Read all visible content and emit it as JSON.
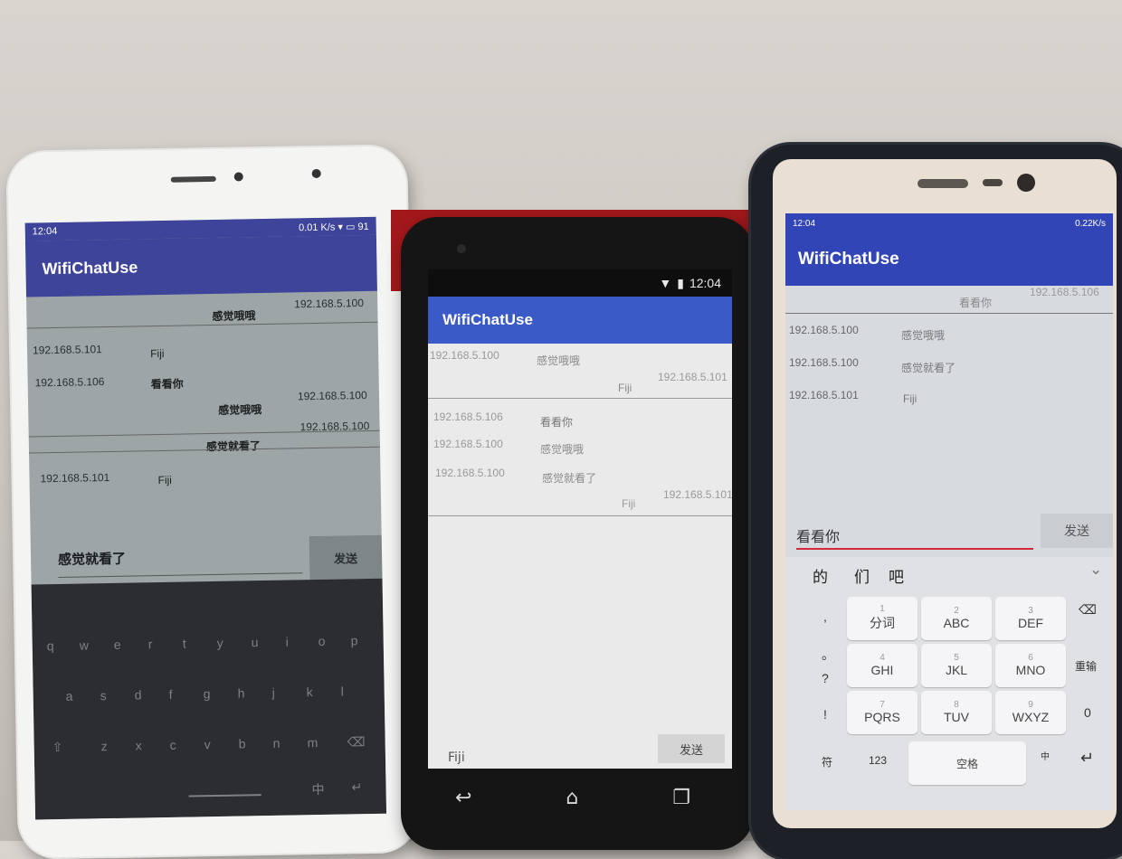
{
  "phone_left": {
    "status": {
      "time": "12:04",
      "right": "0.01 K/s",
      "battery": "91"
    },
    "app_title": "WifiChatUse",
    "messages": [
      {
        "ip": "192.168.5.100",
        "text": "感觉哦哦",
        "side": "right"
      },
      {
        "ip": "192.168.5.101",
        "text": "Fiji",
        "side": "left"
      },
      {
        "ip": "192.168.5.106",
        "text": "看看你",
        "side": "left"
      },
      {
        "ip": "192.168.5.100",
        "text": "感觉哦哦",
        "side": "right"
      },
      {
        "ip": "192.168.5.100",
        "text": "感觉就看了",
        "side": "right"
      },
      {
        "ip": "192.168.5.101",
        "text": "Fiji",
        "side": "left"
      }
    ],
    "input_value": "感觉就看了",
    "send_label": "发送",
    "keyboard_rows": [
      [
        "q",
        "w",
        "e",
        "r",
        "t",
        "y",
        "u",
        "i",
        "o",
        "p"
      ],
      [
        "a",
        "s",
        "d",
        "f",
        "g",
        "h",
        "j",
        "k",
        "l"
      ],
      [
        "z",
        "x",
        "c",
        "v",
        "b",
        "n",
        "m"
      ]
    ],
    "keyboard_bottom": {
      "lang": "中"
    }
  },
  "phone_middle": {
    "status": {
      "time": "12:04"
    },
    "app_title": "WifiChatUse",
    "messages": [
      {
        "ip": "192.168.5.100",
        "text": "感觉哦哦",
        "side": "left"
      },
      {
        "ip": "192.168.5.101",
        "text": "Fiji",
        "side": "right"
      },
      {
        "ip": "192.168.5.106",
        "text": "看看你",
        "side": "left"
      },
      {
        "ip": "192.168.5.100",
        "text": "感觉哦哦",
        "side": "left"
      },
      {
        "ip": "192.168.5.100",
        "text": "感觉就看了",
        "side": "left"
      },
      {
        "ip": "192.168.5.101",
        "text": "Fiji",
        "side": "right"
      }
    ],
    "input_value": "Fiji",
    "send_label": "发送"
  },
  "phone_right": {
    "status": {
      "time": "12:04",
      "right": "0.22K/s"
    },
    "app_title": "WifiChatUse",
    "messages": [
      {
        "ip": "192.168.5.106",
        "text": "看看你",
        "side": "right"
      },
      {
        "ip": "192.168.5.100",
        "text": "感觉哦哦",
        "side": "left"
      },
      {
        "ip": "192.168.5.100",
        "text": "感觉就看了",
        "side": "left"
      },
      {
        "ip": "192.168.5.101",
        "text": "Fiji",
        "side": "left"
      }
    ],
    "input_value": "看看你",
    "send_label": "发送",
    "candidates": [
      "的",
      "们",
      "吧"
    ],
    "keys": [
      {
        "num": "1",
        "label": "分词"
      },
      {
        "num": "2",
        "label": "ABC"
      },
      {
        "num": "3",
        "label": "DEF"
      },
      {
        "num": "4",
        "label": "GHI"
      },
      {
        "num": "5",
        "label": "JKL"
      },
      {
        "num": "6",
        "label": "MNO"
      },
      {
        "num": "7",
        "label": "PQRS"
      },
      {
        "num": "8",
        "label": "TUV"
      },
      {
        "num": "9",
        "label": "WXYZ"
      }
    ],
    "side_keys_left": [
      ",",
      "。",
      "?",
      "!"
    ],
    "side_keys_right": {
      "backspace": "⌫",
      "reenter": "重输",
      "zero": "0",
      "enter": "↵"
    },
    "bottom_row": {
      "symbol": "符",
      "num": "123",
      "space": "空格",
      "lang": "中"
    }
  },
  "colors": {
    "appbar_left": "#3d449a",
    "appbar_middle": "#3a5ac8",
    "appbar_right": "#3245b6",
    "input_underline": "#d0323b"
  }
}
